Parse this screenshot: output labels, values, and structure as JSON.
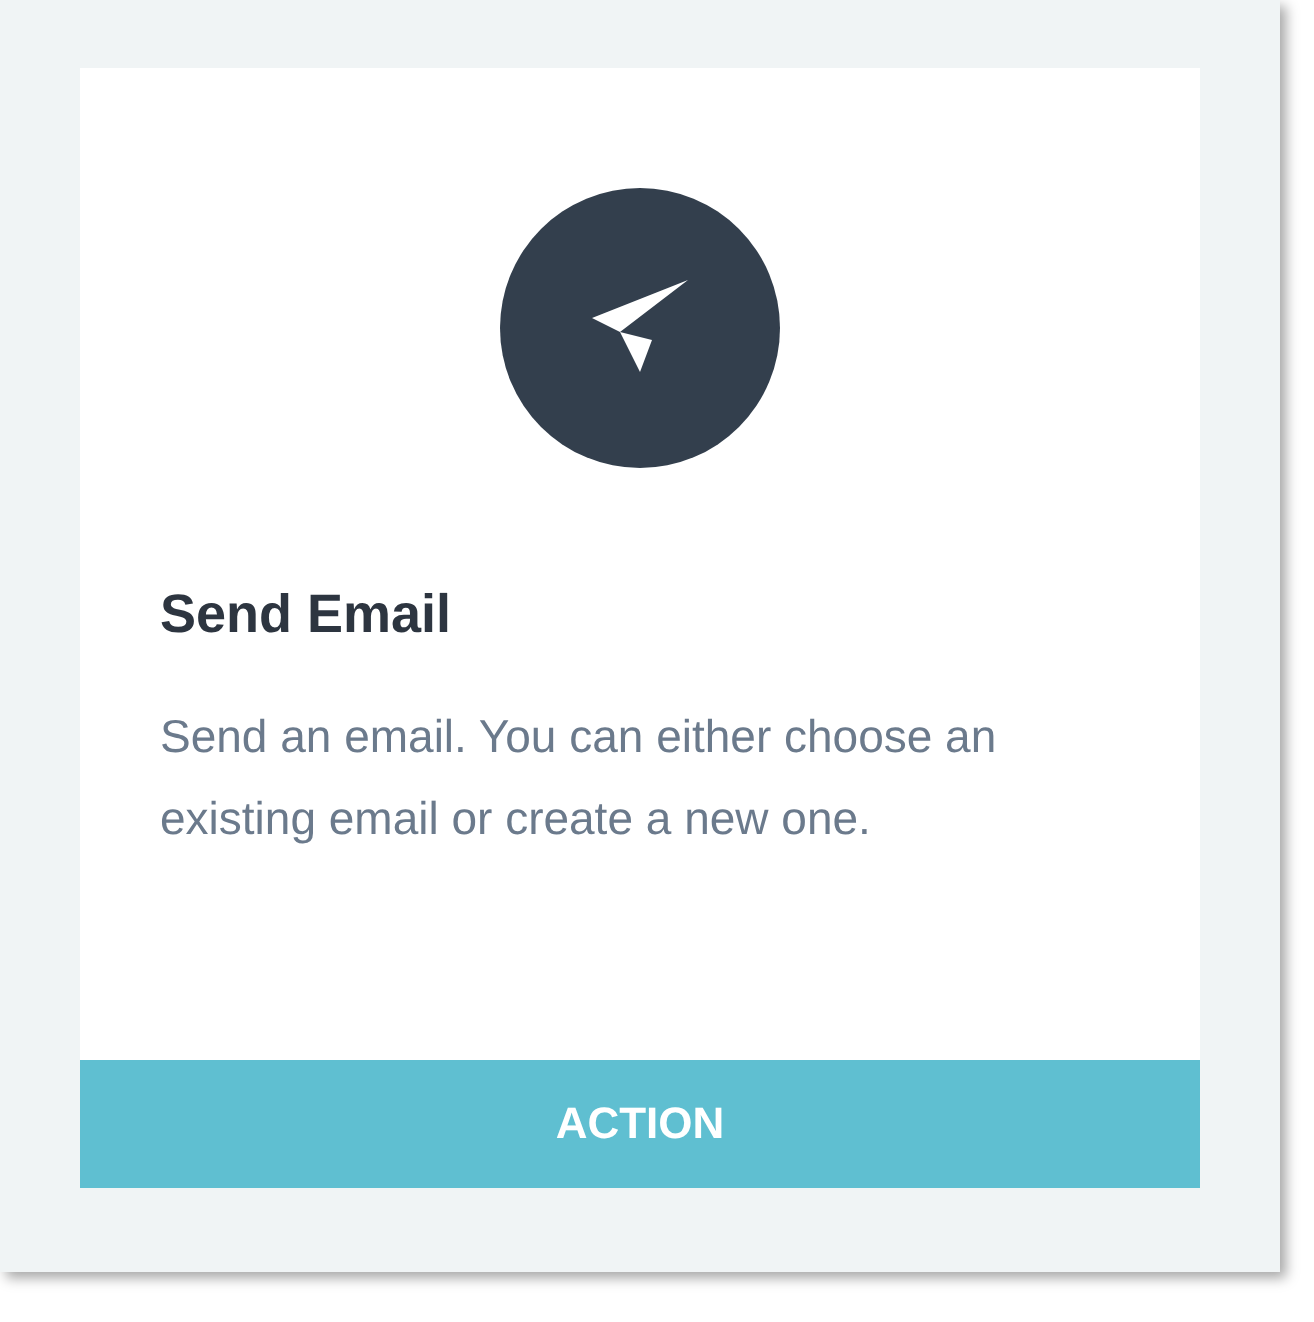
{
  "card": {
    "title": "Send Email",
    "description": "Send an email. You can either choose an existing email or create a new one.",
    "footer_label": "ACTION"
  }
}
